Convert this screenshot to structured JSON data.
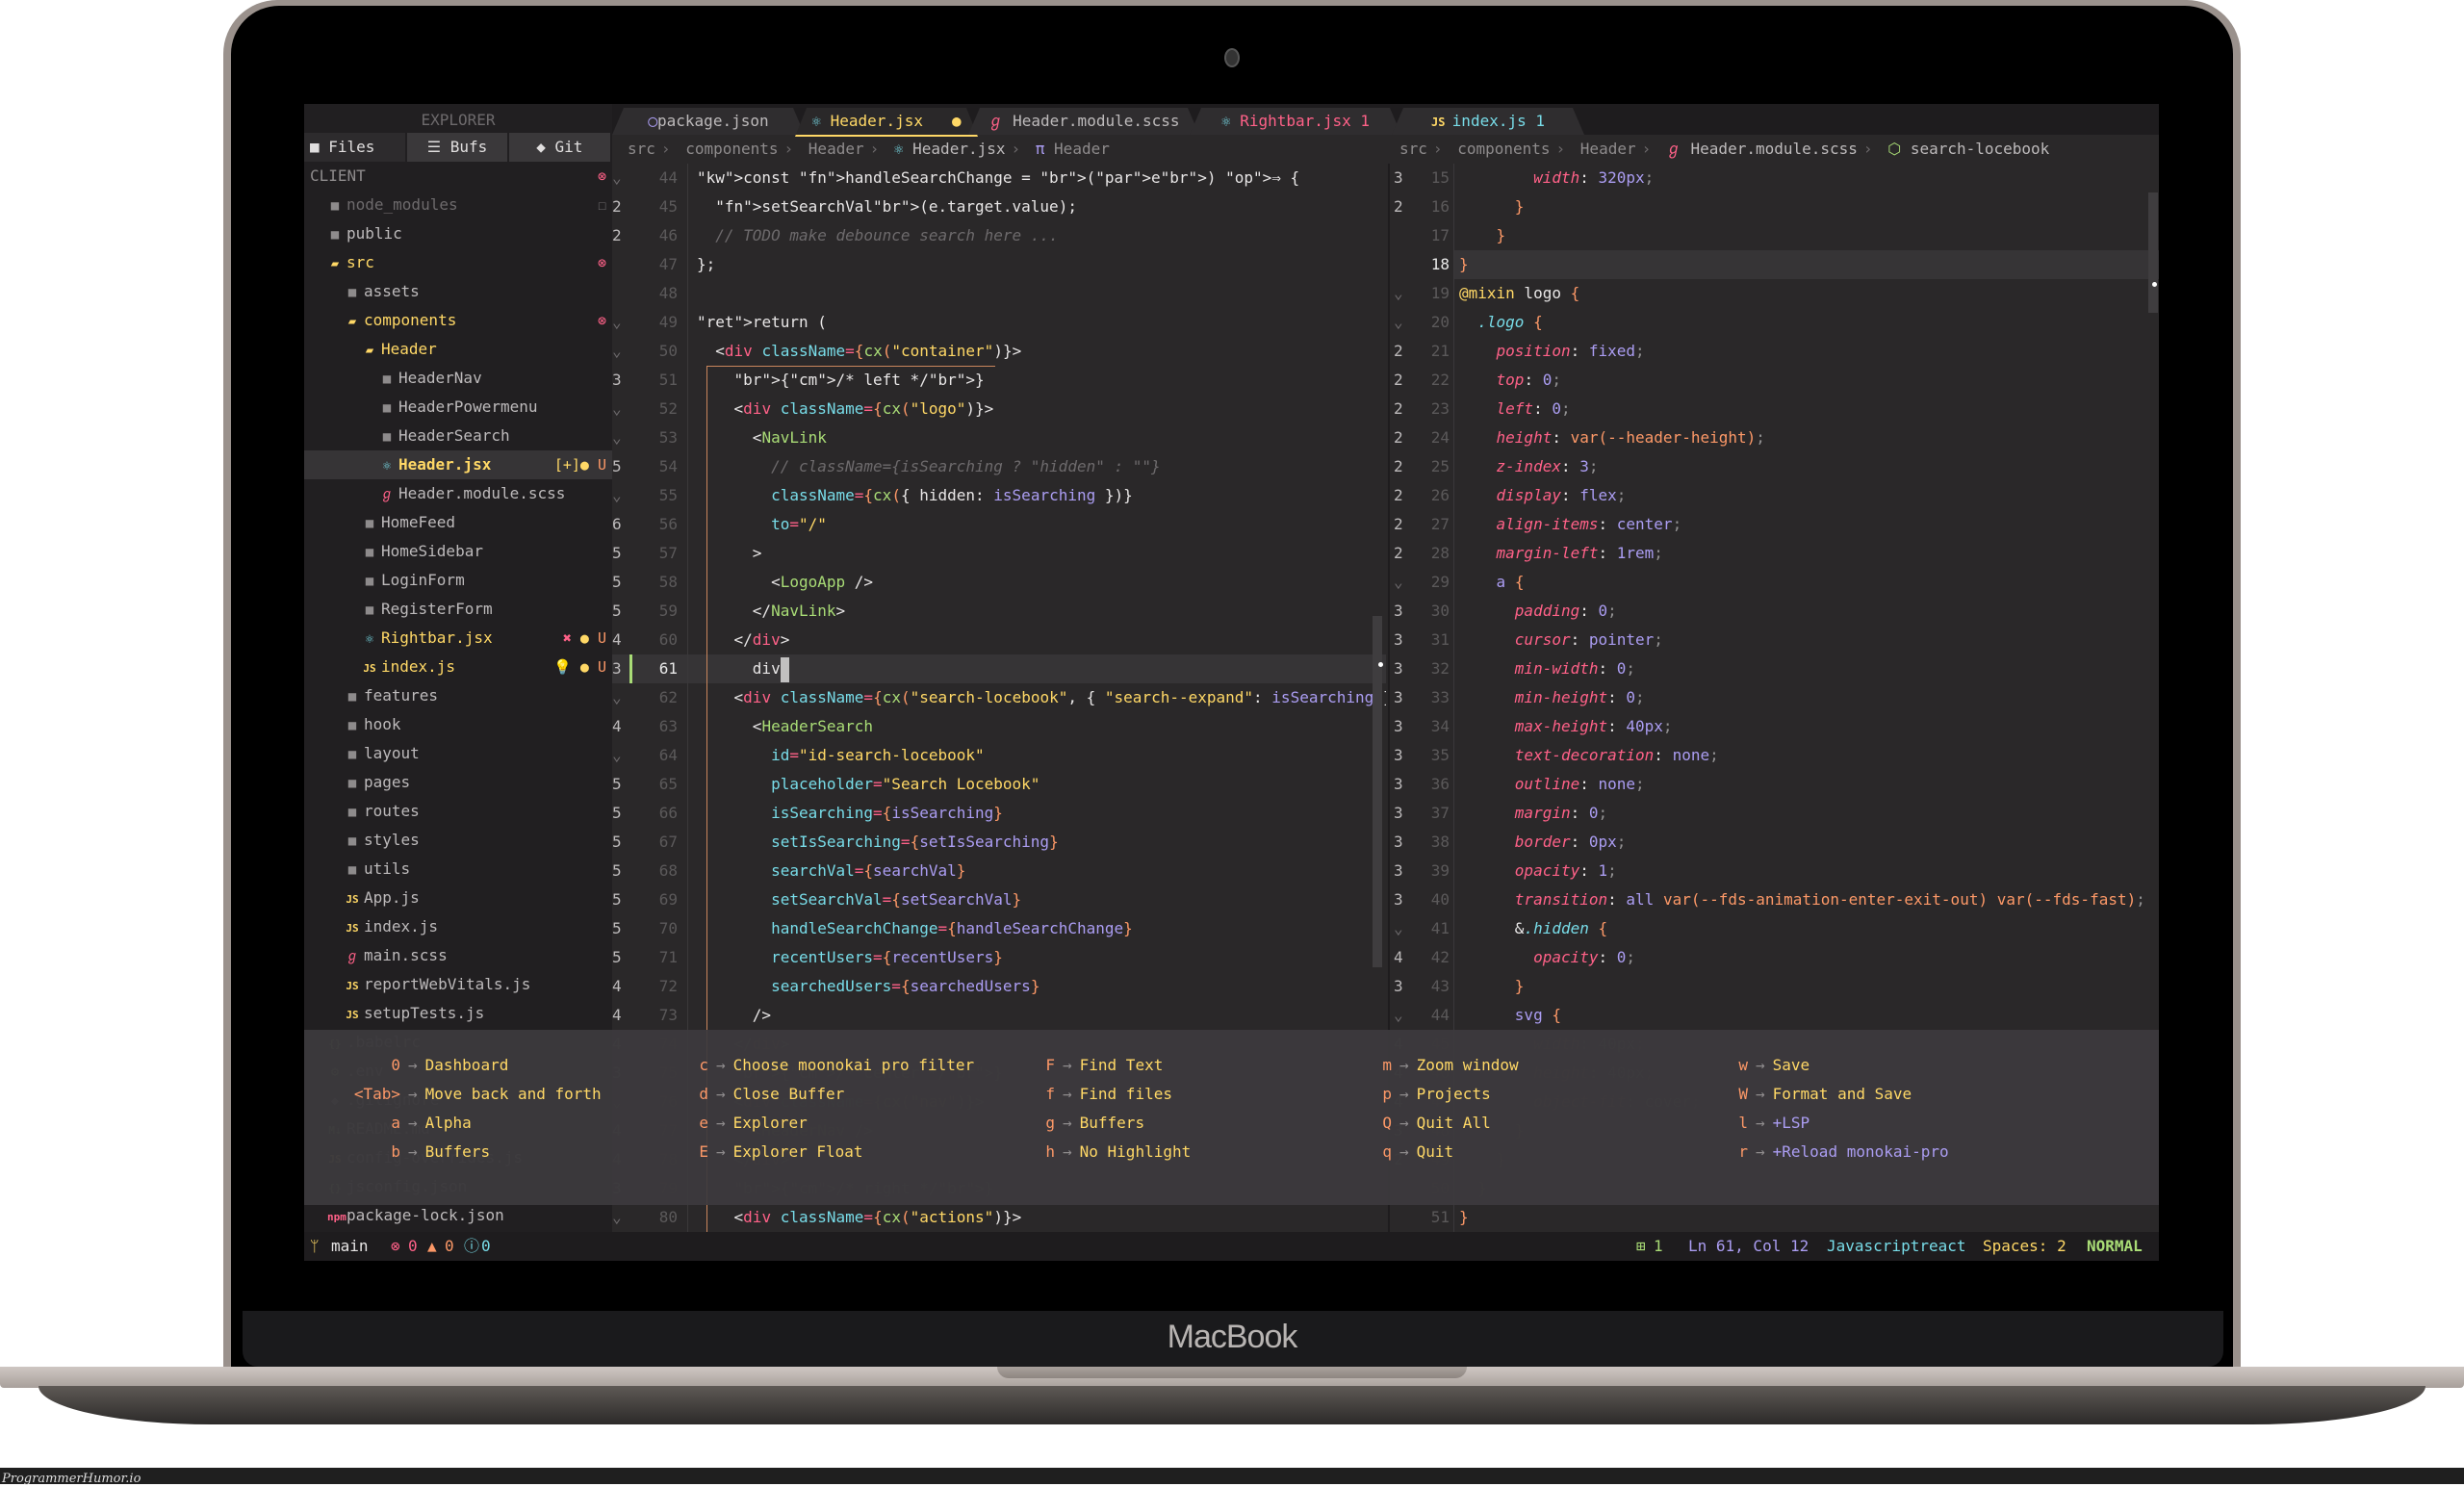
{
  "device": {
    "brand": "MacBook",
    "watermark": "ProgrammerHumor.io"
  },
  "sidebar": {
    "title": "EXPLORER",
    "tabs": [
      {
        "icon": "folder-icon",
        "label": "Files",
        "active": true
      },
      {
        "icon": "buffers-icon",
        "label": "Bufs",
        "active": false
      },
      {
        "icon": "git-icon",
        "label": "Git",
        "active": false
      }
    ],
    "root": "CLIENT",
    "items": [
      {
        "name": "node_modules",
        "type": "folder",
        "depth": 1,
        "deco": "ignored"
      },
      {
        "name": "public",
        "type": "folder",
        "depth": 1
      },
      {
        "name": "src",
        "type": "folder-open",
        "depth": 1,
        "deco": "error"
      },
      {
        "name": "assets",
        "type": "folder",
        "depth": 2
      },
      {
        "name": "components",
        "type": "folder-open",
        "depth": 2,
        "deco": "error"
      },
      {
        "name": "Header",
        "type": "folder-open",
        "depth": 3
      },
      {
        "name": "HeaderNav",
        "type": "folder",
        "depth": 4
      },
      {
        "name": "HeaderPowermenu",
        "type": "folder",
        "depth": 4
      },
      {
        "name": "HeaderSearch",
        "type": "folder",
        "depth": 4
      },
      {
        "name": "Header.jsx",
        "type": "react",
        "depth": 4,
        "deco_text": "[+]● U",
        "selected": true
      },
      {
        "name": "Header.module.scss",
        "type": "sass",
        "depth": 4
      },
      {
        "name": "HomeFeed",
        "type": "folder",
        "depth": 3
      },
      {
        "name": "HomeSidebar",
        "type": "folder",
        "depth": 3
      },
      {
        "name": "LoginForm",
        "type": "folder",
        "depth": 3
      },
      {
        "name": "RegisterForm",
        "type": "folder",
        "depth": 3
      },
      {
        "name": "Rightbar.jsx",
        "type": "react",
        "depth": 3,
        "deco_text": "✖ ● U"
      },
      {
        "name": "index.js",
        "type": "js",
        "depth": 3,
        "deco_text": "💡 ● U"
      },
      {
        "name": "features",
        "type": "folder",
        "depth": 2
      },
      {
        "name": "hook",
        "type": "folder",
        "depth": 2
      },
      {
        "name": "layout",
        "type": "folder",
        "depth": 2
      },
      {
        "name": "pages",
        "type": "folder",
        "depth": 2
      },
      {
        "name": "routes",
        "type": "folder",
        "depth": 2
      },
      {
        "name": "styles",
        "type": "folder",
        "depth": 2
      },
      {
        "name": "utils",
        "type": "folder",
        "depth": 2
      },
      {
        "name": "App.js",
        "type": "js",
        "depth": 2
      },
      {
        "name": "index.js",
        "type": "js",
        "depth": 2
      },
      {
        "name": "main.scss",
        "type": "sass",
        "depth": 2
      },
      {
        "name": "reportWebVitals.js",
        "type": "js",
        "depth": 2
      },
      {
        "name": "setupTests.js",
        "type": "js",
        "depth": 2
      },
      {
        "name": ".babelrc",
        "type": "json",
        "depth": 1
      },
      {
        "name": ".env",
        "type": "env",
        "depth": 1
      },
      {
        "name": ".gitignore",
        "type": "git",
        "depth": 1
      },
      {
        "name": "README.md",
        "type": "md",
        "depth": 1
      },
      {
        "name": "config-overrides.js",
        "type": "js",
        "depth": 1
      },
      {
        "name": "jsconfig.json",
        "type": "json",
        "depth": 1
      },
      {
        "name": "package-lock.json",
        "type": "npm",
        "depth": 1
      }
    ]
  },
  "tabs": [
    {
      "label": "package.json",
      "icon": "json-icon",
      "state": "normal"
    },
    {
      "label": "Header.jsx",
      "icon": "react-icon",
      "state": "active",
      "modified": true
    },
    {
      "label": "Header.module.scss",
      "icon": "sass-icon",
      "state": "normal"
    },
    {
      "label": "Rightbar.jsx 1",
      "icon": "react-icon",
      "state": "error"
    },
    {
      "label": "index.js 1",
      "icon": "js-icon",
      "state": "warning"
    }
  ],
  "left_editor": {
    "breadcrumb": [
      "src",
      "components",
      "Header",
      "Header.jsx",
      "Header"
    ],
    "cursor_line": 61,
    "gutter": [
      "⌄",
      "2",
      "2",
      "",
      "",
      "⌄",
      "⌄",
      "3",
      "⌄",
      "⌄",
      "5",
      "⌄",
      "6",
      "5",
      "5",
      "5",
      "4",
      "3",
      "⌄",
      "4",
      "⌄",
      "5",
      "5",
      "5",
      "5",
      "5",
      "5",
      "5",
      "4",
      "4",
      "4",
      "3",
      "⌄",
      "4",
      "4",
      "3",
      "⌄"
    ],
    "line_numbers": [
      44,
      45,
      46,
      47,
      48,
      49,
      50,
      51,
      52,
      53,
      54,
      55,
      56,
      57,
      58,
      59,
      60,
      61,
      62,
      63,
      64,
      65,
      66,
      67,
      68,
      69,
      70,
      71,
      72,
      73,
      74,
      75,
      76,
      77,
      78,
      79,
      80
    ],
    "lines": [
      "const handleSearchChange = (e) ⇒ {",
      "  setSearchVal(e.target.value);",
      "  // TODO make debounce search here ...",
      "};",
      "",
      "return (",
      "  <div className={cx(\"container\")}>",
      "    {/* left */}",
      "    <div className={cx(\"logo\")}>",
      "      <NavLink",
      "        // className={isSearching ? \"hidden\" : \"\"}",
      "        className={cx({ hidden: isSearching })}",
      "        to=\"/\"",
      "      >",
      "        <LogoApp />",
      "      </NavLink>",
      "    </div>",
      "      div",
      "    <div className={cx(\"search-locebook\", { \"search--expand\": isSearching })}>",
      "      <HeaderSearch",
      "        id=\"id-search-locebook\"",
      "        placeholder=\"Search Locebook\"",
      "        isSearching={isSearching}",
      "        setIsSearching={setIsSearching}",
      "        searchVal={searchVal}",
      "        setSearchVal={setSearchVal}",
      "        handleSearchChange={handleSearchChange}",
      "        recentUsers={recentUsers}",
      "        searchedUsers={searchedUsers}",
      "      />",
      "    </div>",
      "    {/* center */}",
      "    <div className={cx(\"nav\")}>",
      "      <HeaderNav />",
      "    </div>",
      "    {/* right */}",
      "    <div className={cx(\"actions\")}>"
    ]
  },
  "right_editor": {
    "breadcrumb": [
      "src",
      "components",
      "Header",
      "Header.module.scss",
      "search-locebook"
    ],
    "gutter": [
      "3",
      "2",
      "",
      "",
      "⌄",
      "⌄",
      "2",
      "2",
      "2",
      "2",
      "2",
      "2",
      "2",
      "2",
      "⌄",
      "3",
      "3",
      "3",
      "3",
      "3",
      "3",
      "3",
      "3",
      "3",
      "3",
      "3",
      "⌄",
      "4",
      "3",
      "⌄",
      "4",
      "4",
      "4",
      "3",
      "2",
      "",
      ""
    ],
    "line_numbers": [
      15,
      16,
      17,
      18,
      19,
      20,
      21,
      22,
      23,
      24,
      25,
      26,
      27,
      28,
      29,
      30,
      31,
      32,
      33,
      34,
      35,
      36,
      37,
      38,
      39,
      40,
      41,
      42,
      43,
      44,
      45,
      46,
      47,
      48,
      49,
      50,
      51
    ],
    "current_line": 18,
    "lines": [
      "        width: 320px;",
      "      }",
      "    }",
      "}",
      "@mixin logo {",
      "  .logo {",
      "    position: fixed;",
      "    top: 0;",
      "    left: 0;",
      "    height: var(--header-height);",
      "    z-index: 3;",
      "    display: flex;",
      "    align-items: center;",
      "    margin-left: 1rem;",
      "    a {",
      "      padding: 0;",
      "      cursor: pointer;",
      "      min-width: 0;",
      "      min-height: 0;",
      "      max-height: 40px;",
      "      text-decoration: none;",
      "      outline: none;",
      "      margin: 0;",
      "      border: 0px;",
      "      opacity: 1;",
      "      transition: all var(--fds-animation-enter-exit-out) var(--fds-fast);",
      "      &.hidden {",
      "        opacity: 0;",
      "      }",
      "      svg {",
      "        width: 40px;",
      "        height: 40px;",
      "        object-fit: cover;",
      "      }",
      "    }",
      "  }",
      "}"
    ]
  },
  "which_key": {
    "columns": [
      [
        {
          "key": "0",
          "label": "Dashboard"
        },
        {
          "key": "<Tab>",
          "label": "Move back and forth"
        },
        {
          "key": "a",
          "label": "Alpha"
        },
        {
          "key": "b",
          "label": "Buffers"
        }
      ],
      [
        {
          "key": "c",
          "label": "Choose moonokai pro filter"
        },
        {
          "key": "d",
          "label": "Close Buffer"
        },
        {
          "key": "e",
          "label": "Explorer"
        },
        {
          "key": "E",
          "label": "Explorer Float"
        }
      ],
      [
        {
          "key": "F",
          "label": "Find Text"
        },
        {
          "key": "f",
          "label": "Find files"
        },
        {
          "key": "g",
          "label": "Buffers"
        },
        {
          "key": "h",
          "label": "No Highlight"
        }
      ],
      [
        {
          "key": "m",
          "label": "Zoom window"
        },
        {
          "key": "p",
          "label": "Projects"
        },
        {
          "key": "Q",
          "label": "Quit All"
        },
        {
          "key": "q",
          "label": "Quit"
        }
      ],
      [
        {
          "key": "w",
          "label": "Save"
        },
        {
          "key": "W",
          "label": "Format and Save"
        },
        {
          "key": "l",
          "label": "+LSP",
          "group": true
        },
        {
          "key": "r",
          "label": "+Reload monokai-pro",
          "group": true
        }
      ]
    ]
  },
  "statusbar": {
    "branch": "main",
    "errors": "0",
    "warnings": "0",
    "info": "0",
    "diff_added": "1",
    "position": "Ln 61, Col 12",
    "language": "Javascriptreact",
    "indent": "Spaces: 2",
    "mode": "NORMAL"
  },
  "colors": {
    "bg": "#2a2829",
    "sidebar_bg": "#211f21",
    "accent_yellow": "#ffd866",
    "accent_pink": "#ff6188",
    "accent_orange": "#fc9867",
    "accent_green": "#a9dc76",
    "accent_cyan": "#78dce8",
    "accent_purple": "#ab9df2"
  }
}
